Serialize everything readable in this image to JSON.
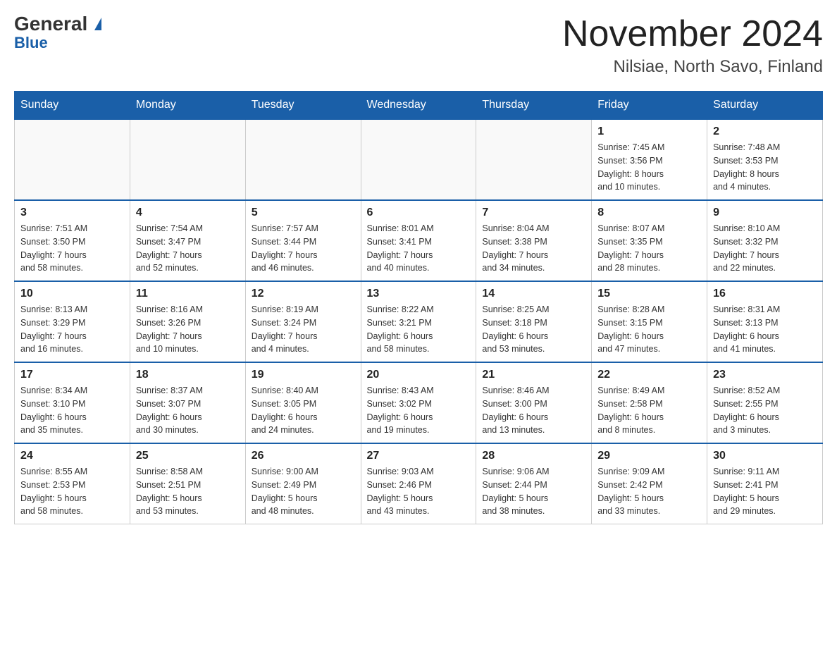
{
  "header": {
    "logo_general": "General",
    "logo_blue": "Blue",
    "month_title": "November 2024",
    "location": "Nilsiae, North Savo, Finland"
  },
  "weekdays": [
    "Sunday",
    "Monday",
    "Tuesday",
    "Wednesday",
    "Thursday",
    "Friday",
    "Saturday"
  ],
  "weeks": [
    [
      {
        "day": "",
        "info": ""
      },
      {
        "day": "",
        "info": ""
      },
      {
        "day": "",
        "info": ""
      },
      {
        "day": "",
        "info": ""
      },
      {
        "day": "",
        "info": ""
      },
      {
        "day": "1",
        "info": "Sunrise: 7:45 AM\nSunset: 3:56 PM\nDaylight: 8 hours\nand 10 minutes."
      },
      {
        "day": "2",
        "info": "Sunrise: 7:48 AM\nSunset: 3:53 PM\nDaylight: 8 hours\nand 4 minutes."
      }
    ],
    [
      {
        "day": "3",
        "info": "Sunrise: 7:51 AM\nSunset: 3:50 PM\nDaylight: 7 hours\nand 58 minutes."
      },
      {
        "day": "4",
        "info": "Sunrise: 7:54 AM\nSunset: 3:47 PM\nDaylight: 7 hours\nand 52 minutes."
      },
      {
        "day": "5",
        "info": "Sunrise: 7:57 AM\nSunset: 3:44 PM\nDaylight: 7 hours\nand 46 minutes."
      },
      {
        "day": "6",
        "info": "Sunrise: 8:01 AM\nSunset: 3:41 PM\nDaylight: 7 hours\nand 40 minutes."
      },
      {
        "day": "7",
        "info": "Sunrise: 8:04 AM\nSunset: 3:38 PM\nDaylight: 7 hours\nand 34 minutes."
      },
      {
        "day": "8",
        "info": "Sunrise: 8:07 AM\nSunset: 3:35 PM\nDaylight: 7 hours\nand 28 minutes."
      },
      {
        "day": "9",
        "info": "Sunrise: 8:10 AM\nSunset: 3:32 PM\nDaylight: 7 hours\nand 22 minutes."
      }
    ],
    [
      {
        "day": "10",
        "info": "Sunrise: 8:13 AM\nSunset: 3:29 PM\nDaylight: 7 hours\nand 16 minutes."
      },
      {
        "day": "11",
        "info": "Sunrise: 8:16 AM\nSunset: 3:26 PM\nDaylight: 7 hours\nand 10 minutes."
      },
      {
        "day": "12",
        "info": "Sunrise: 8:19 AM\nSunset: 3:24 PM\nDaylight: 7 hours\nand 4 minutes."
      },
      {
        "day": "13",
        "info": "Sunrise: 8:22 AM\nSunset: 3:21 PM\nDaylight: 6 hours\nand 58 minutes."
      },
      {
        "day": "14",
        "info": "Sunrise: 8:25 AM\nSunset: 3:18 PM\nDaylight: 6 hours\nand 53 minutes."
      },
      {
        "day": "15",
        "info": "Sunrise: 8:28 AM\nSunset: 3:15 PM\nDaylight: 6 hours\nand 47 minutes."
      },
      {
        "day": "16",
        "info": "Sunrise: 8:31 AM\nSunset: 3:13 PM\nDaylight: 6 hours\nand 41 minutes."
      }
    ],
    [
      {
        "day": "17",
        "info": "Sunrise: 8:34 AM\nSunset: 3:10 PM\nDaylight: 6 hours\nand 35 minutes."
      },
      {
        "day": "18",
        "info": "Sunrise: 8:37 AM\nSunset: 3:07 PM\nDaylight: 6 hours\nand 30 minutes."
      },
      {
        "day": "19",
        "info": "Sunrise: 8:40 AM\nSunset: 3:05 PM\nDaylight: 6 hours\nand 24 minutes."
      },
      {
        "day": "20",
        "info": "Sunrise: 8:43 AM\nSunset: 3:02 PM\nDaylight: 6 hours\nand 19 minutes."
      },
      {
        "day": "21",
        "info": "Sunrise: 8:46 AM\nSunset: 3:00 PM\nDaylight: 6 hours\nand 13 minutes."
      },
      {
        "day": "22",
        "info": "Sunrise: 8:49 AM\nSunset: 2:58 PM\nDaylight: 6 hours\nand 8 minutes."
      },
      {
        "day": "23",
        "info": "Sunrise: 8:52 AM\nSunset: 2:55 PM\nDaylight: 6 hours\nand 3 minutes."
      }
    ],
    [
      {
        "day": "24",
        "info": "Sunrise: 8:55 AM\nSunset: 2:53 PM\nDaylight: 5 hours\nand 58 minutes."
      },
      {
        "day": "25",
        "info": "Sunrise: 8:58 AM\nSunset: 2:51 PM\nDaylight: 5 hours\nand 53 minutes."
      },
      {
        "day": "26",
        "info": "Sunrise: 9:00 AM\nSunset: 2:49 PM\nDaylight: 5 hours\nand 48 minutes."
      },
      {
        "day": "27",
        "info": "Sunrise: 9:03 AM\nSunset: 2:46 PM\nDaylight: 5 hours\nand 43 minutes."
      },
      {
        "day": "28",
        "info": "Sunrise: 9:06 AM\nSunset: 2:44 PM\nDaylight: 5 hours\nand 38 minutes."
      },
      {
        "day": "29",
        "info": "Sunrise: 9:09 AM\nSunset: 2:42 PM\nDaylight: 5 hours\nand 33 minutes."
      },
      {
        "day": "30",
        "info": "Sunrise: 9:11 AM\nSunset: 2:41 PM\nDaylight: 5 hours\nand 29 minutes."
      }
    ]
  ]
}
